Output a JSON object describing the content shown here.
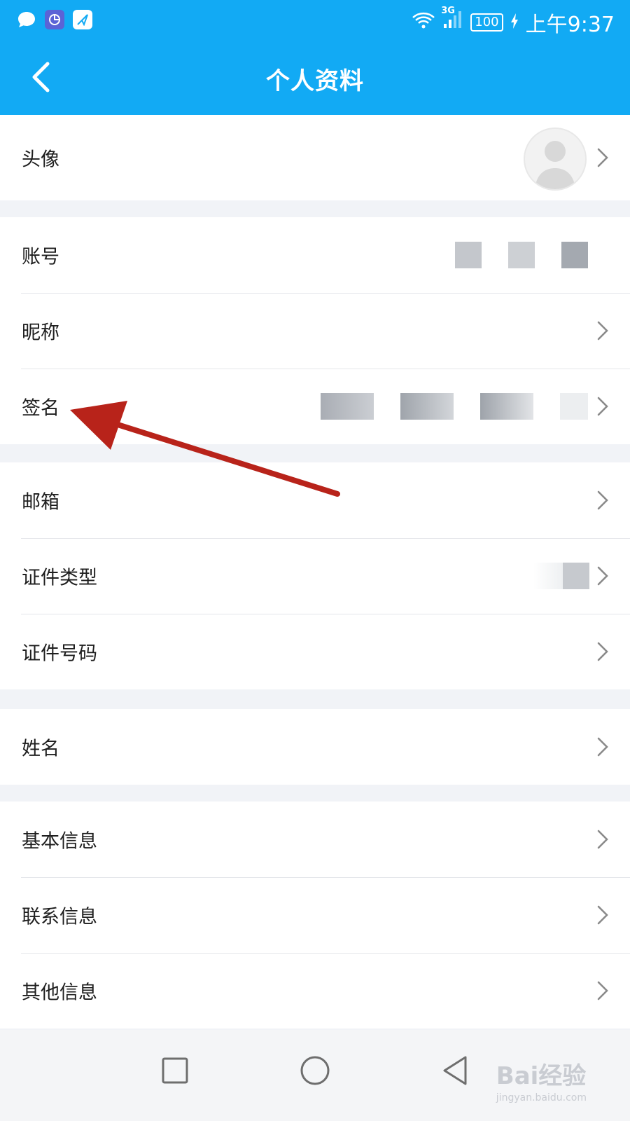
{
  "status_bar": {
    "time": "上午9:37",
    "network": "3G",
    "battery": "100",
    "icons": [
      "message-icon",
      "chart-app-icon",
      "send-app-icon",
      "wifi-icon",
      "signal-icon",
      "battery-icon",
      "charging-icon"
    ]
  },
  "header": {
    "title": "个人资料",
    "back_icon": "chevron-left-icon"
  },
  "colors": {
    "accent": "#12aaf4",
    "annotation_arrow": "#b8231a"
  },
  "groups": [
    {
      "rows": [
        {
          "label": "头像"
        }
      ]
    },
    {
      "rows": [
        {
          "label": "账号"
        },
        {
          "label": "昵称"
        },
        {
          "label": "签名"
        }
      ]
    },
    {
      "rows": [
        {
          "label": "邮箱"
        },
        {
          "label": "证件类型"
        },
        {
          "label": "证件号码"
        }
      ]
    },
    {
      "rows": [
        {
          "label": "姓名"
        }
      ]
    },
    {
      "rows": [
        {
          "label": "基本信息"
        },
        {
          "label": "联系信息"
        },
        {
          "label": "其他信息"
        }
      ]
    }
  ],
  "bottom_nav": {
    "icons": [
      "recent-apps-icon",
      "home-icon",
      "back-icon"
    ]
  },
  "watermark": {
    "text": "Bai经验",
    "sub": "jingyan.baidu.com"
  }
}
